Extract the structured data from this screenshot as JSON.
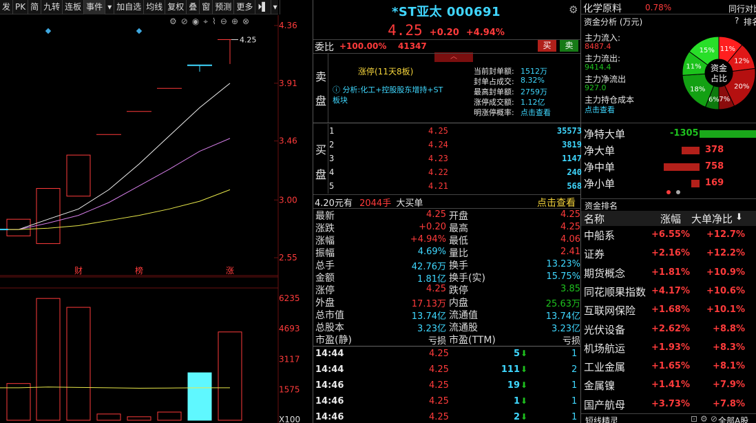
{
  "toolbar": {
    "items": [
      "发",
      "PK",
      "简",
      "九转",
      "连板",
      "事件",
      "▾",
      "加自选",
      "均线",
      "复权",
      "叠",
      "窗",
      "预测",
      "更多",
      "⏵▌",
      "▾"
    ]
  },
  "chart": {
    "price_labels": [
      "4.36",
      "3.91",
      "3.46",
      "3.00",
      "2.55"
    ],
    "volume_labels": [
      "6235",
      "4693",
      "3117",
      "1575",
      "X100"
    ],
    "last_price_tag": "4.25",
    "event_markers": [
      "财",
      "榜",
      "涨"
    ],
    "tool_icons": [
      "⚙",
      "⊘",
      "◉",
      "⌖",
      "⌇",
      "⊖",
      "⊕",
      "⊗"
    ]
  },
  "chart_data": {
    "type": "candlestick",
    "candles": [
      {
        "o": 2.72,
        "c": 2.85,
        "h": 2.85,
        "l": 2.72
      },
      {
        "o": 2.66,
        "c": 3.09,
        "h": 3.09,
        "l": 2.66
      },
      {
        "o": 3.03,
        "c": 3.35,
        "h": 3.35,
        "l": 3.03
      },
      {
        "o": 3.51,
        "c": 3.51,
        "h": 3.51,
        "l": 3.51
      },
      {
        "o": 3.69,
        "c": 3.69,
        "h": 3.69,
        "l": 3.69
      },
      {
        "o": 3.87,
        "c": 3.87,
        "h": 3.87,
        "l": 3.87
      },
      {
        "o": 4.05,
        "c": 4.06,
        "h": 4.06,
        "l": 4.02
      },
      {
        "o": 4.25,
        "c": 4.25,
        "h": 4.25,
        "l": 4.06
      }
    ],
    "ma_white": [
      2.77,
      2.85,
      2.93,
      3.08,
      3.28,
      3.5,
      3.72,
      3.91
    ],
    "ma_violet": [
      2.77,
      2.82,
      2.88,
      2.98,
      3.11,
      3.24,
      3.38,
      3.48
    ],
    "ma_yellow": [
      2.77,
      2.78,
      2.8,
      2.84,
      2.88,
      2.93,
      2.99,
      3.08
    ],
    "price_range": [
      2.4,
      4.43
    ],
    "volumes": [
      1880,
      6235,
      5780,
      320,
      180,
      420,
      2430,
      4520
    ],
    "volume_colors": [
      "red",
      "red",
      "red",
      "red",
      "red",
      "red",
      "cyan",
      "red"
    ],
    "volume_range": [
      0,
      6700
    ],
    "vol_ma": [
      1660,
      1700,
      1680,
      1660,
      1640,
      1650,
      1660,
      1660
    ]
  },
  "stock": {
    "name": "*ST亚太 000691",
    "price": "4.25",
    "change": "+0.20",
    "change_pct": "+4.94%"
  },
  "weibi": {
    "label": "委比",
    "pct": "+100.00%",
    "diff": "41347",
    "buy_btn": "买",
    "sell_btn": "卖"
  },
  "sell_side": {
    "label1": "卖",
    "label2": "盘",
    "limit_text": "涨停(11天8板)",
    "analysis": "ⓘ 分析:化工+控股股东增持+ST板块"
  },
  "seal_info": [
    {
      "k": "当前封单额:",
      "v": "1512万"
    },
    {
      "k": "封单占成交:",
      "v": "8.32%"
    },
    {
      "k": "最高封单额:",
      "v": "2759万"
    },
    {
      "k": "涨停成交额:",
      "v": "1.12亿"
    },
    {
      "k": "明涨停概率:",
      "v": "点击查看"
    }
  ],
  "buy_side": {
    "label1": "买",
    "label2": "盘",
    "rows": [
      {
        "lv": "1",
        "price": "4.25",
        "vol": "35573"
      },
      {
        "lv": "2",
        "price": "4.24",
        "vol": "3819"
      },
      {
        "lv": "3",
        "price": "4.23",
        "vol": "1147"
      },
      {
        "lv": "4",
        "price": "4.22",
        "vol": "240"
      },
      {
        "lv": "5",
        "price": "4.21",
        "vol": "568"
      }
    ]
  },
  "big_buy": {
    "price": "4.20",
    "yuan": "元有",
    "amount": "2044手",
    "text": "大买单",
    "link": "点击查看"
  },
  "quote": [
    {
      "k1": "最新",
      "v1": "4.25",
      "c1": "red",
      "k2": "开盘",
      "v2": "4.25",
      "c2": "red"
    },
    {
      "k1": "涨跌",
      "v1": "+0.20",
      "c1": "red",
      "k2": "最高",
      "v2": "4.25",
      "c2": "red"
    },
    {
      "k1": "涨幅",
      "v1": "+4.94%",
      "c1": "red",
      "k2": "最低",
      "v2": "4.06",
      "c2": "red"
    },
    {
      "k1": "振幅",
      "v1": "4.69%",
      "c1": "cyan",
      "k2": "量比",
      "v2": "2.41",
      "c2": "red"
    },
    {
      "k1": "总手",
      "v1": "42.76万",
      "c1": "cyan",
      "k2": "换手",
      "v2": "13.23%",
      "c2": "cyan"
    },
    {
      "k1": "金额",
      "v1": "1.81亿",
      "c1": "cyan",
      "k2": "换手(实)",
      "v2": "15.75%",
      "c2": "cyan"
    },
    {
      "k1": "涨停",
      "v1": "4.25",
      "c1": "red",
      "k2": "跌停",
      "v2": "3.85",
      "c2": "grn"
    },
    {
      "k1": "外盘",
      "v1": "17.13万",
      "c1": "red",
      "k2": "内盘",
      "v2": "25.63万",
      "c2": "grn"
    },
    {
      "k1": "总市值",
      "v1": "13.74亿",
      "c1": "cyan",
      "k2": "流通值",
      "v2": "13.74亿",
      "c2": "cyan"
    },
    {
      "k1": "总股本",
      "v1": "3.23亿",
      "c1": "cyan",
      "k2": "流通股",
      "v2": "3.23亿",
      "c2": "cyan"
    },
    {
      "k1": "市盈(静)",
      "v1": "亏损",
      "c1": "wht",
      "k2": "市盈(TTM)",
      "v2": "亏损",
      "c2": "wht"
    }
  ],
  "ticks": [
    {
      "t": "14:44",
      "p": "4.25",
      "v": "5",
      "n": "1"
    },
    {
      "t": "14:44",
      "p": "4.25",
      "v": "111",
      "n": "2"
    },
    {
      "t": "14:46",
      "p": "4.25",
      "v": "19",
      "n": "1"
    },
    {
      "t": "14:46",
      "p": "4.25",
      "v": "1",
      "n": "1"
    },
    {
      "t": "14:46",
      "p": "4.25",
      "v": "2",
      "n": "1"
    }
  ],
  "right": {
    "sector": "化学原料",
    "sector_pct": "0.78%",
    "sector_more": "同行对比",
    "fund_title": "资金分析 (万元)",
    "fund_q": "?",
    "fund_rank": "排名",
    "fund_rows": [
      {
        "k": "主力流入:",
        "v": "8487.4",
        "c": "red"
      },
      {
        "k": "主力流出:",
        "v": "9414.4",
        "c": "grn"
      },
      {
        "k": "主力净流出",
        "v": "927.0",
        "c": "grn"
      },
      {
        "k": "主力持仓成本",
        "v": "点击查看",
        "c": "cyan"
      }
    ],
    "donut_center": [
      "资金",
      "占比"
    ],
    "donut_slices": [
      {
        "label": "11%",
        "val": 11,
        "color": "#ff1f1f"
      },
      {
        "label": "12%",
        "val": 12,
        "color": "#e01818"
      },
      {
        "label": "20%",
        "val": 20,
        "color": "#b51010"
      },
      {
        "label": "7%",
        "val": 7,
        "color": "#8a0c0c"
      },
      {
        "label": "6%",
        "val": 6,
        "color": "#0d7a0d"
      },
      {
        "label": "18%",
        "val": 18,
        "color": "#13a013"
      },
      {
        "label": "11%",
        "val": 11,
        "color": "#1cc21c"
      },
      {
        "label": "15%",
        "val": 15,
        "color": "#29df29"
      }
    ],
    "net": [
      {
        "k": "净特大单",
        "v": "-1305",
        "c": "grn",
        "w": 1.0
      },
      {
        "k": "净大单",
        "v": "378",
        "c": "red",
        "w": 0.29
      },
      {
        "k": "净中单",
        "v": "758",
        "c": "red",
        "w": 0.58
      },
      {
        "k": "净小单",
        "v": "169",
        "c": "red",
        "w": 0.13
      }
    ],
    "rank_title": "资金排名",
    "rank_headers": [
      "名称",
      "涨幅",
      "大单净比"
    ],
    "rank_rows": [
      {
        "n": "中船系",
        "a": "+6.55%",
        "b": "+12.7%"
      },
      {
        "n": "证券",
        "a": "+2.16%",
        "b": "+12.2%"
      },
      {
        "n": "期货概念",
        "a": "+1.81%",
        "b": "+10.9%"
      },
      {
        "n": "同花顺果指数",
        "a": "+4.17%",
        "b": "+10.6%"
      },
      {
        "n": "互联网保险",
        "a": "+1.68%",
        "b": "+10.1%"
      },
      {
        "n": "光伏设备",
        "a": "+2.62%",
        "b": "+8.8%"
      },
      {
        "n": "机场航运",
        "a": "+1.93%",
        "b": "+8.3%"
      },
      {
        "n": "工业金属",
        "a": "+1.65%",
        "b": "+8.1%"
      },
      {
        "n": "金属镍",
        "a": "+1.41%",
        "b": "+7.9%"
      },
      {
        "n": "国产航母",
        "a": "+3.73%",
        "b": "+7.8%"
      }
    ],
    "bottom_left": "短线精灵",
    "bottom_right": "全部A股"
  }
}
